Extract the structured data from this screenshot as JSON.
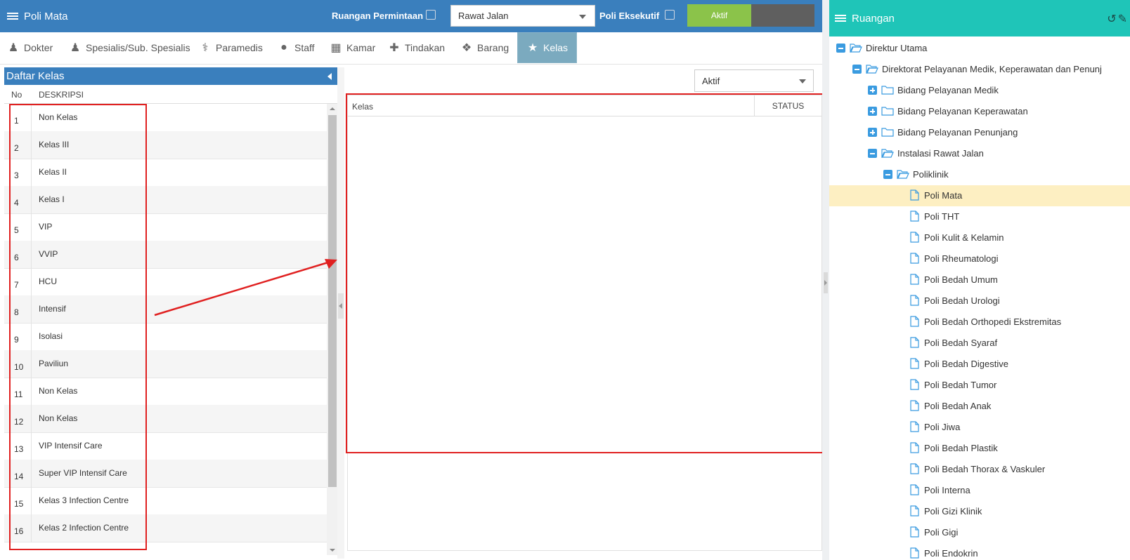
{
  "topbar": {
    "title": "Poli Mata",
    "ruangan_permintaan_label": "Ruangan Permintaan",
    "rawat_select_value": "Rawat Jalan",
    "poli_eksekutif_label": "Poli Eksekutif",
    "aktif_label": "Aktif",
    "color": "#3a7fbd"
  },
  "tabs": [
    {
      "label": "Dokter",
      "icon": "user-tie-icon",
      "glyph": "♟"
    },
    {
      "label": "Spesialis/Sub. Spesialis",
      "icon": "user-md-icon",
      "glyph": "♟"
    },
    {
      "label": "Paramedis",
      "icon": "stethoscope-icon",
      "glyph": "⚕"
    },
    {
      "label": "Staff",
      "icon": "user-icon",
      "glyph": "●"
    },
    {
      "label": "Kamar",
      "icon": "building-icon",
      "glyph": "▦"
    },
    {
      "label": "Tindakan",
      "icon": "medkit-icon",
      "glyph": "✚"
    },
    {
      "label": "Barang",
      "icon": "cubes-icon",
      "glyph": "❖"
    },
    {
      "label": "Kelas",
      "icon": "star-icon",
      "glyph": "★",
      "active": true
    }
  ],
  "kelas_panel": {
    "title": "Daftar Kelas",
    "col_no": "No",
    "col_desc": "DESKRIPSI",
    "rows": [
      {
        "no": "1",
        "desc": "Non Kelas"
      },
      {
        "no": "2",
        "desc": "Kelas III"
      },
      {
        "no": "3",
        "desc": "Kelas II"
      },
      {
        "no": "4",
        "desc": "Kelas I"
      },
      {
        "no": "5",
        "desc": "VIP"
      },
      {
        "no": "6",
        "desc": "VVIP"
      },
      {
        "no": "7",
        "desc": "HCU"
      },
      {
        "no": "8",
        "desc": "Intensif"
      },
      {
        "no": "9",
        "desc": "Isolasi"
      },
      {
        "no": "10",
        "desc": "Paviliun"
      },
      {
        "no": "11",
        "desc": "Non Kelas"
      },
      {
        "no": "12",
        "desc": "Non Kelas"
      },
      {
        "no": "13",
        "desc": "VIP Intensif Care"
      },
      {
        "no": "14",
        "desc": "Super VIP Intensif Care"
      },
      {
        "no": "15",
        "desc": "Kelas 3 Infection Centre"
      },
      {
        "no": "16",
        "desc": "Kelas 2 Infection Centre"
      }
    ]
  },
  "content": {
    "status_select_value": "Aktif",
    "grid_col_kelas": "Kelas",
    "grid_col_status": "STATUS"
  },
  "ruangan": {
    "title": "Ruangan",
    "color": "#1fc5b8",
    "tree": [
      {
        "label": "Direktur Utama",
        "level": 0,
        "toggle": "minus",
        "icon": "folder-open-icon"
      },
      {
        "label": "Direktorat Pelayanan Medik, Keperawatan dan Penunj",
        "level": 1,
        "toggle": "minus",
        "icon": "folder-open-icon"
      },
      {
        "label": "Bidang Pelayanan Medik",
        "level": 2,
        "toggle": "plus",
        "icon": "folder-icon"
      },
      {
        "label": "Bidang Pelayanan Keperawatan",
        "level": 2,
        "toggle": "plus",
        "icon": "folder-icon"
      },
      {
        "label": "Bidang Pelayanan Penunjang",
        "level": 2,
        "toggle": "plus",
        "icon": "folder-icon"
      },
      {
        "label": "Instalasi Rawat Jalan",
        "level": 2,
        "toggle": "minus",
        "icon": "folder-open-icon"
      },
      {
        "label": "Poliklinik",
        "level": 3,
        "toggle": "minus",
        "icon": "folder-open-icon"
      },
      {
        "label": "Poli Mata",
        "level": 4,
        "icon": "file-icon",
        "selected": true
      },
      {
        "label": "Poli THT",
        "level": 4,
        "icon": "file-icon"
      },
      {
        "label": "Poli Kulit & Kelamin",
        "level": 4,
        "icon": "file-icon"
      },
      {
        "label": "Poli Rheumatologi",
        "level": 4,
        "icon": "file-icon"
      },
      {
        "label": "Poli Bedah Umum",
        "level": 4,
        "icon": "file-icon"
      },
      {
        "label": "Poli Bedah Urologi",
        "level": 4,
        "icon": "file-icon"
      },
      {
        "label": "Poli Bedah Orthopedi Ekstremitas",
        "level": 4,
        "icon": "file-icon"
      },
      {
        "label": "Poli Bedah Syaraf",
        "level": 4,
        "icon": "file-icon"
      },
      {
        "label": "Poli Bedah Digestive",
        "level": 4,
        "icon": "file-icon"
      },
      {
        "label": "Poli Bedah Tumor",
        "level": 4,
        "icon": "file-icon"
      },
      {
        "label": "Poli Bedah Anak",
        "level": 4,
        "icon": "file-icon"
      },
      {
        "label": "Poli Jiwa",
        "level": 4,
        "icon": "file-icon"
      },
      {
        "label": "Poli Bedah Plastik",
        "level": 4,
        "icon": "file-icon"
      },
      {
        "label": "Poli Bedah Thorax & Vaskuler",
        "level": 4,
        "icon": "file-icon"
      },
      {
        "label": "Poli Interna",
        "level": 4,
        "icon": "file-icon"
      },
      {
        "label": "Poli Gizi Klinik",
        "level": 4,
        "icon": "file-icon"
      },
      {
        "label": "Poli Gigi",
        "level": 4,
        "icon": "file-icon"
      },
      {
        "label": "Poli Endokrin",
        "level": 4,
        "icon": "file-icon"
      }
    ]
  },
  "annotation_color": "#e02020"
}
